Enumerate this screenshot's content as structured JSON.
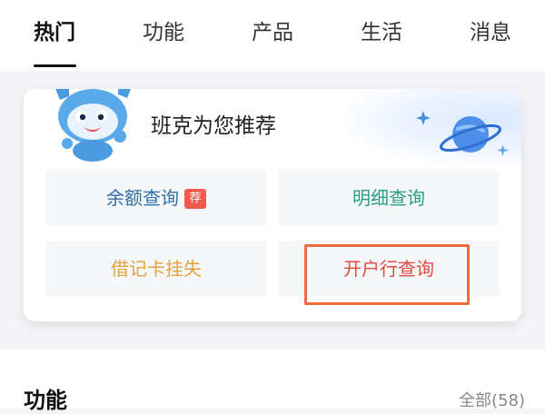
{
  "tabs": [
    {
      "label": "热门",
      "active": true
    },
    {
      "label": "功能",
      "active": false
    },
    {
      "label": "产品",
      "active": false
    },
    {
      "label": "生活",
      "active": false
    },
    {
      "label": "消息",
      "active": false
    }
  ],
  "recommend": {
    "title": "班克为您推荐",
    "items": [
      {
        "label": "余额查询",
        "badge": "荐",
        "color": "#2f6fa8"
      },
      {
        "label": "明细查询",
        "badge": "",
        "color": "#2a9d86"
      },
      {
        "label": "借记卡挂失",
        "badge": "",
        "color": "#e2a43a"
      },
      {
        "label": "开户行查询",
        "badge": "",
        "color": "#e1493f",
        "highlighted": true
      }
    ]
  },
  "section": {
    "title": "功能",
    "more": "全部(58)"
  },
  "colors": {
    "highlight_border": "#f26a3c",
    "badge_bg": "#f05a4f"
  },
  "icons": [
    "mascot-icon",
    "planet-icon",
    "sparkle-icon"
  ]
}
